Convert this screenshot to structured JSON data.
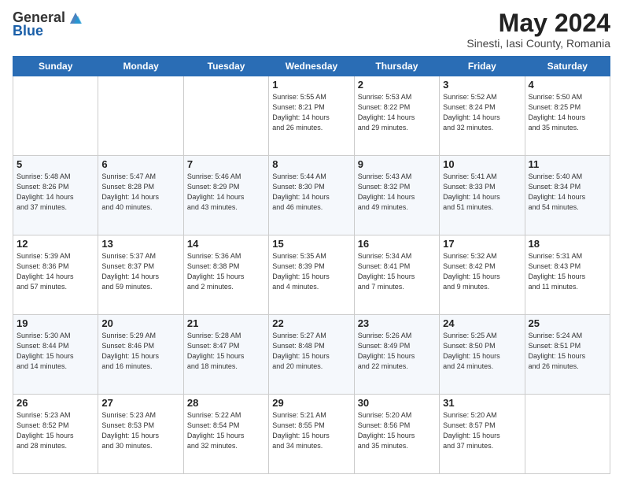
{
  "header": {
    "logo_general": "General",
    "logo_blue": "Blue",
    "month_title": "May 2024",
    "subtitle": "Sinesti, Iasi County, Romania"
  },
  "weekdays": [
    "Sunday",
    "Monday",
    "Tuesday",
    "Wednesday",
    "Thursday",
    "Friday",
    "Saturday"
  ],
  "weeks": [
    [
      {
        "day": "",
        "info": ""
      },
      {
        "day": "",
        "info": ""
      },
      {
        "day": "",
        "info": ""
      },
      {
        "day": "1",
        "info": "Sunrise: 5:55 AM\nSunset: 8:21 PM\nDaylight: 14 hours\nand 26 minutes."
      },
      {
        "day": "2",
        "info": "Sunrise: 5:53 AM\nSunset: 8:22 PM\nDaylight: 14 hours\nand 29 minutes."
      },
      {
        "day": "3",
        "info": "Sunrise: 5:52 AM\nSunset: 8:24 PM\nDaylight: 14 hours\nand 32 minutes."
      },
      {
        "day": "4",
        "info": "Sunrise: 5:50 AM\nSunset: 8:25 PM\nDaylight: 14 hours\nand 35 minutes."
      }
    ],
    [
      {
        "day": "5",
        "info": "Sunrise: 5:48 AM\nSunset: 8:26 PM\nDaylight: 14 hours\nand 37 minutes."
      },
      {
        "day": "6",
        "info": "Sunrise: 5:47 AM\nSunset: 8:28 PM\nDaylight: 14 hours\nand 40 minutes."
      },
      {
        "day": "7",
        "info": "Sunrise: 5:46 AM\nSunset: 8:29 PM\nDaylight: 14 hours\nand 43 minutes."
      },
      {
        "day": "8",
        "info": "Sunrise: 5:44 AM\nSunset: 8:30 PM\nDaylight: 14 hours\nand 46 minutes."
      },
      {
        "day": "9",
        "info": "Sunrise: 5:43 AM\nSunset: 8:32 PM\nDaylight: 14 hours\nand 49 minutes."
      },
      {
        "day": "10",
        "info": "Sunrise: 5:41 AM\nSunset: 8:33 PM\nDaylight: 14 hours\nand 51 minutes."
      },
      {
        "day": "11",
        "info": "Sunrise: 5:40 AM\nSunset: 8:34 PM\nDaylight: 14 hours\nand 54 minutes."
      }
    ],
    [
      {
        "day": "12",
        "info": "Sunrise: 5:39 AM\nSunset: 8:36 PM\nDaylight: 14 hours\nand 57 minutes."
      },
      {
        "day": "13",
        "info": "Sunrise: 5:37 AM\nSunset: 8:37 PM\nDaylight: 14 hours\nand 59 minutes."
      },
      {
        "day": "14",
        "info": "Sunrise: 5:36 AM\nSunset: 8:38 PM\nDaylight: 15 hours\nand 2 minutes."
      },
      {
        "day": "15",
        "info": "Sunrise: 5:35 AM\nSunset: 8:39 PM\nDaylight: 15 hours\nand 4 minutes."
      },
      {
        "day": "16",
        "info": "Sunrise: 5:34 AM\nSunset: 8:41 PM\nDaylight: 15 hours\nand 7 minutes."
      },
      {
        "day": "17",
        "info": "Sunrise: 5:32 AM\nSunset: 8:42 PM\nDaylight: 15 hours\nand 9 minutes."
      },
      {
        "day": "18",
        "info": "Sunrise: 5:31 AM\nSunset: 8:43 PM\nDaylight: 15 hours\nand 11 minutes."
      }
    ],
    [
      {
        "day": "19",
        "info": "Sunrise: 5:30 AM\nSunset: 8:44 PM\nDaylight: 15 hours\nand 14 minutes."
      },
      {
        "day": "20",
        "info": "Sunrise: 5:29 AM\nSunset: 8:46 PM\nDaylight: 15 hours\nand 16 minutes."
      },
      {
        "day": "21",
        "info": "Sunrise: 5:28 AM\nSunset: 8:47 PM\nDaylight: 15 hours\nand 18 minutes."
      },
      {
        "day": "22",
        "info": "Sunrise: 5:27 AM\nSunset: 8:48 PM\nDaylight: 15 hours\nand 20 minutes."
      },
      {
        "day": "23",
        "info": "Sunrise: 5:26 AM\nSunset: 8:49 PM\nDaylight: 15 hours\nand 22 minutes."
      },
      {
        "day": "24",
        "info": "Sunrise: 5:25 AM\nSunset: 8:50 PM\nDaylight: 15 hours\nand 24 minutes."
      },
      {
        "day": "25",
        "info": "Sunrise: 5:24 AM\nSunset: 8:51 PM\nDaylight: 15 hours\nand 26 minutes."
      }
    ],
    [
      {
        "day": "26",
        "info": "Sunrise: 5:23 AM\nSunset: 8:52 PM\nDaylight: 15 hours\nand 28 minutes."
      },
      {
        "day": "27",
        "info": "Sunrise: 5:23 AM\nSunset: 8:53 PM\nDaylight: 15 hours\nand 30 minutes."
      },
      {
        "day": "28",
        "info": "Sunrise: 5:22 AM\nSunset: 8:54 PM\nDaylight: 15 hours\nand 32 minutes."
      },
      {
        "day": "29",
        "info": "Sunrise: 5:21 AM\nSunset: 8:55 PM\nDaylight: 15 hours\nand 34 minutes."
      },
      {
        "day": "30",
        "info": "Sunrise: 5:20 AM\nSunset: 8:56 PM\nDaylight: 15 hours\nand 35 minutes."
      },
      {
        "day": "31",
        "info": "Sunrise: 5:20 AM\nSunset: 8:57 PM\nDaylight: 15 hours\nand 37 minutes."
      },
      {
        "day": "",
        "info": ""
      }
    ]
  ]
}
